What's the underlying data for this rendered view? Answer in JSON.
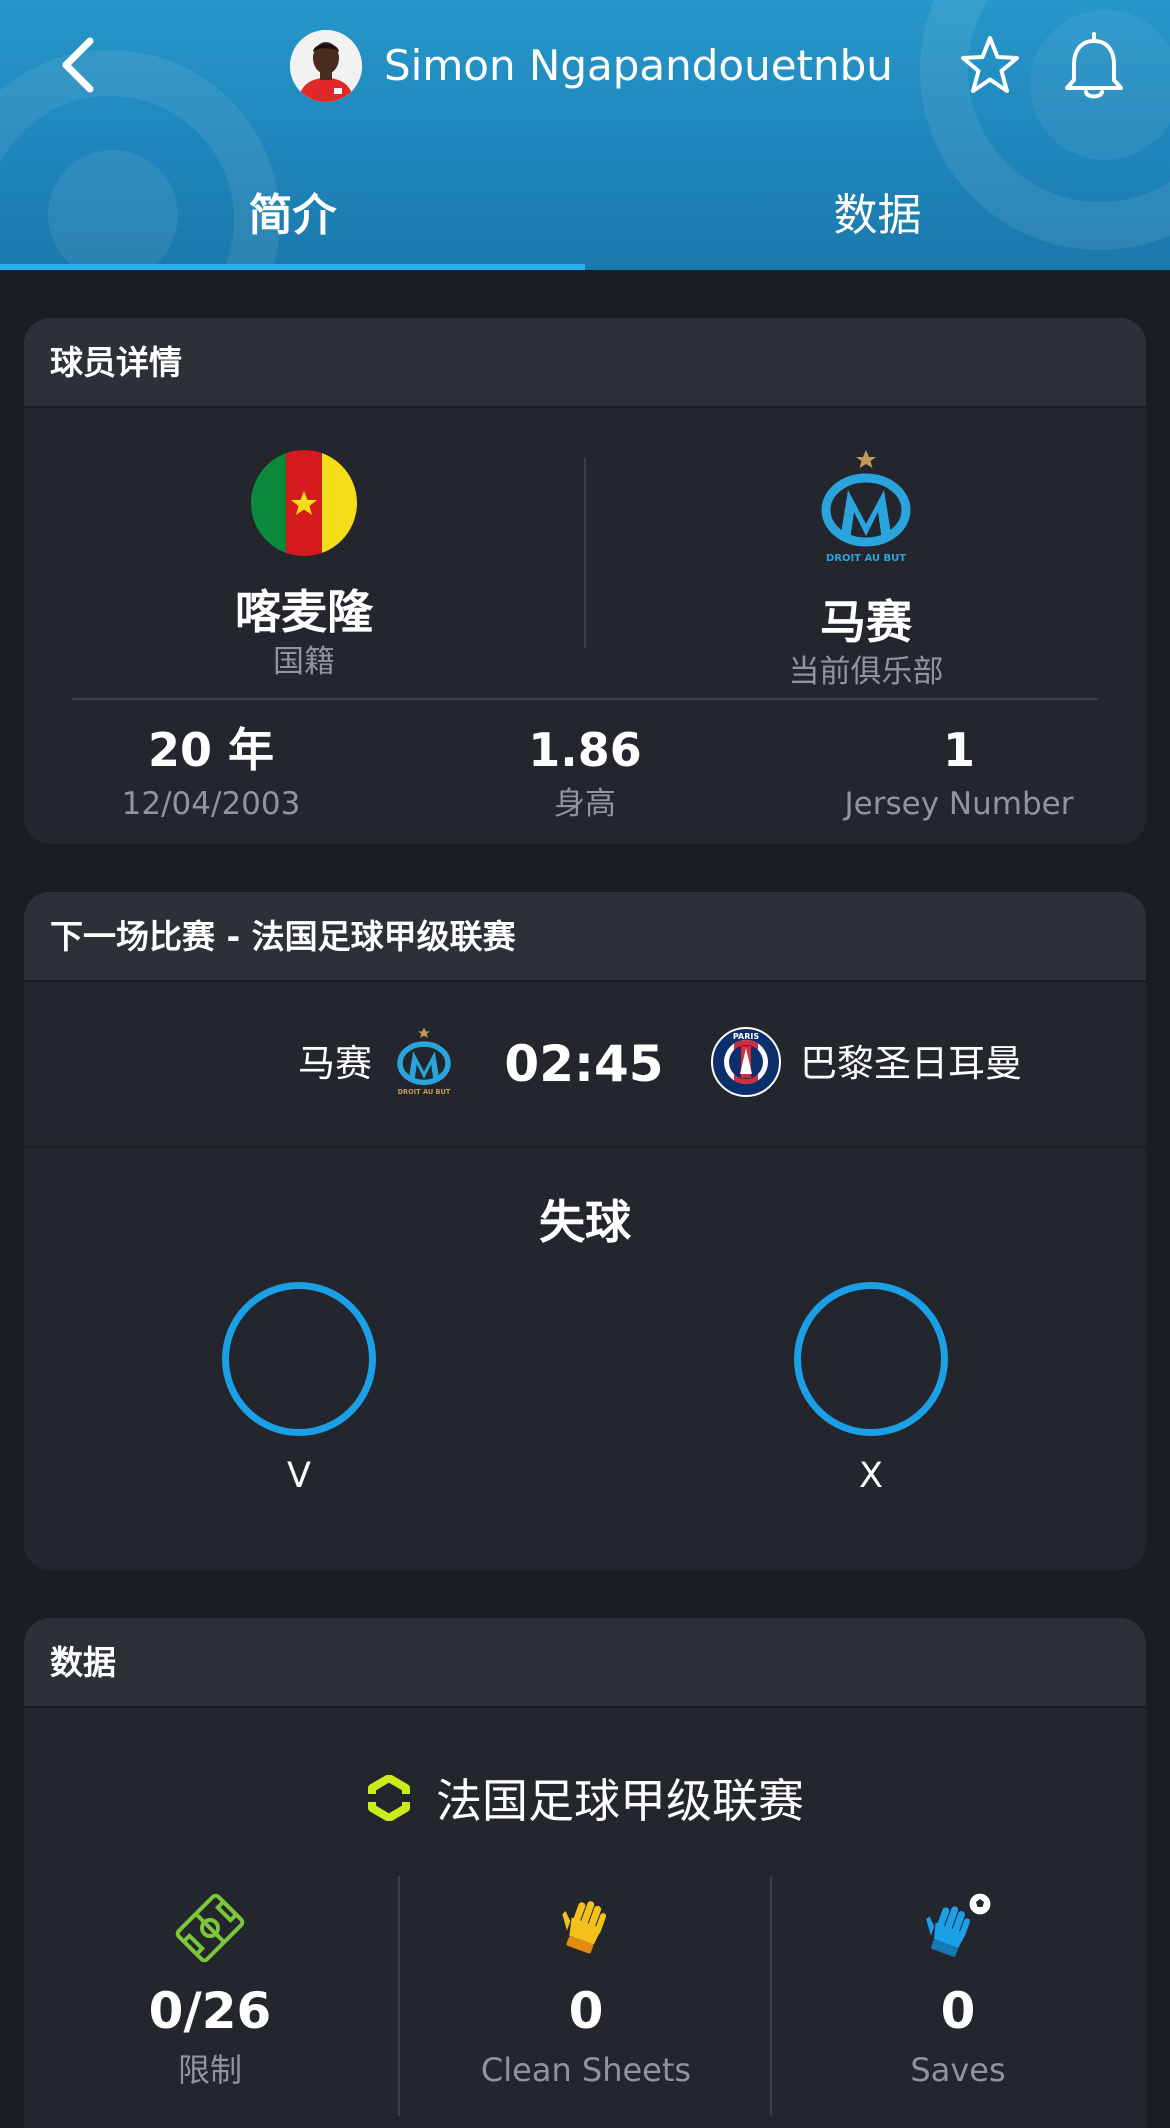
{
  "header": {
    "player_name": "Simon Ngapandouetnbu",
    "tabs": [
      {
        "label": "简介",
        "active": true
      },
      {
        "label": "数据",
        "active": false
      }
    ]
  },
  "details": {
    "title": "球员详情",
    "nationality_value": "喀麦隆",
    "nationality_label": "国籍",
    "club_value": "马赛",
    "club_label": "当前俱乐部",
    "age_value": "20 年",
    "birth_date": "12/04/2003",
    "height_value": "1.86",
    "height_label": "身高",
    "jersey_value": "1",
    "jersey_label": "Jersey Number"
  },
  "next_match": {
    "title": "下一场比赛 - 法国足球甲级联赛",
    "home_team": "马赛",
    "away_team": "巴黎圣日耳曼",
    "time": "02:45",
    "conceded_title": "失球",
    "home_form": "V",
    "away_form": "X"
  },
  "stats": {
    "title": "数据",
    "league": "法国足球甲级联赛",
    "items": [
      {
        "value": "0/26",
        "label": "限制",
        "icon": "pitch-icon"
      },
      {
        "value": "0",
        "label": "Clean Sheets",
        "icon": "glove-icon"
      },
      {
        "value": "0",
        "label": "Saves",
        "icon": "save-glove-icon"
      }
    ]
  },
  "colors": {
    "header_blue": "#2797c9",
    "accent_blue": "#1b9fe6",
    "card_bg": "#23272d",
    "page_bg": "#1a1e23",
    "muted_text": "#8e959e",
    "league_green": "#cdea1b"
  }
}
